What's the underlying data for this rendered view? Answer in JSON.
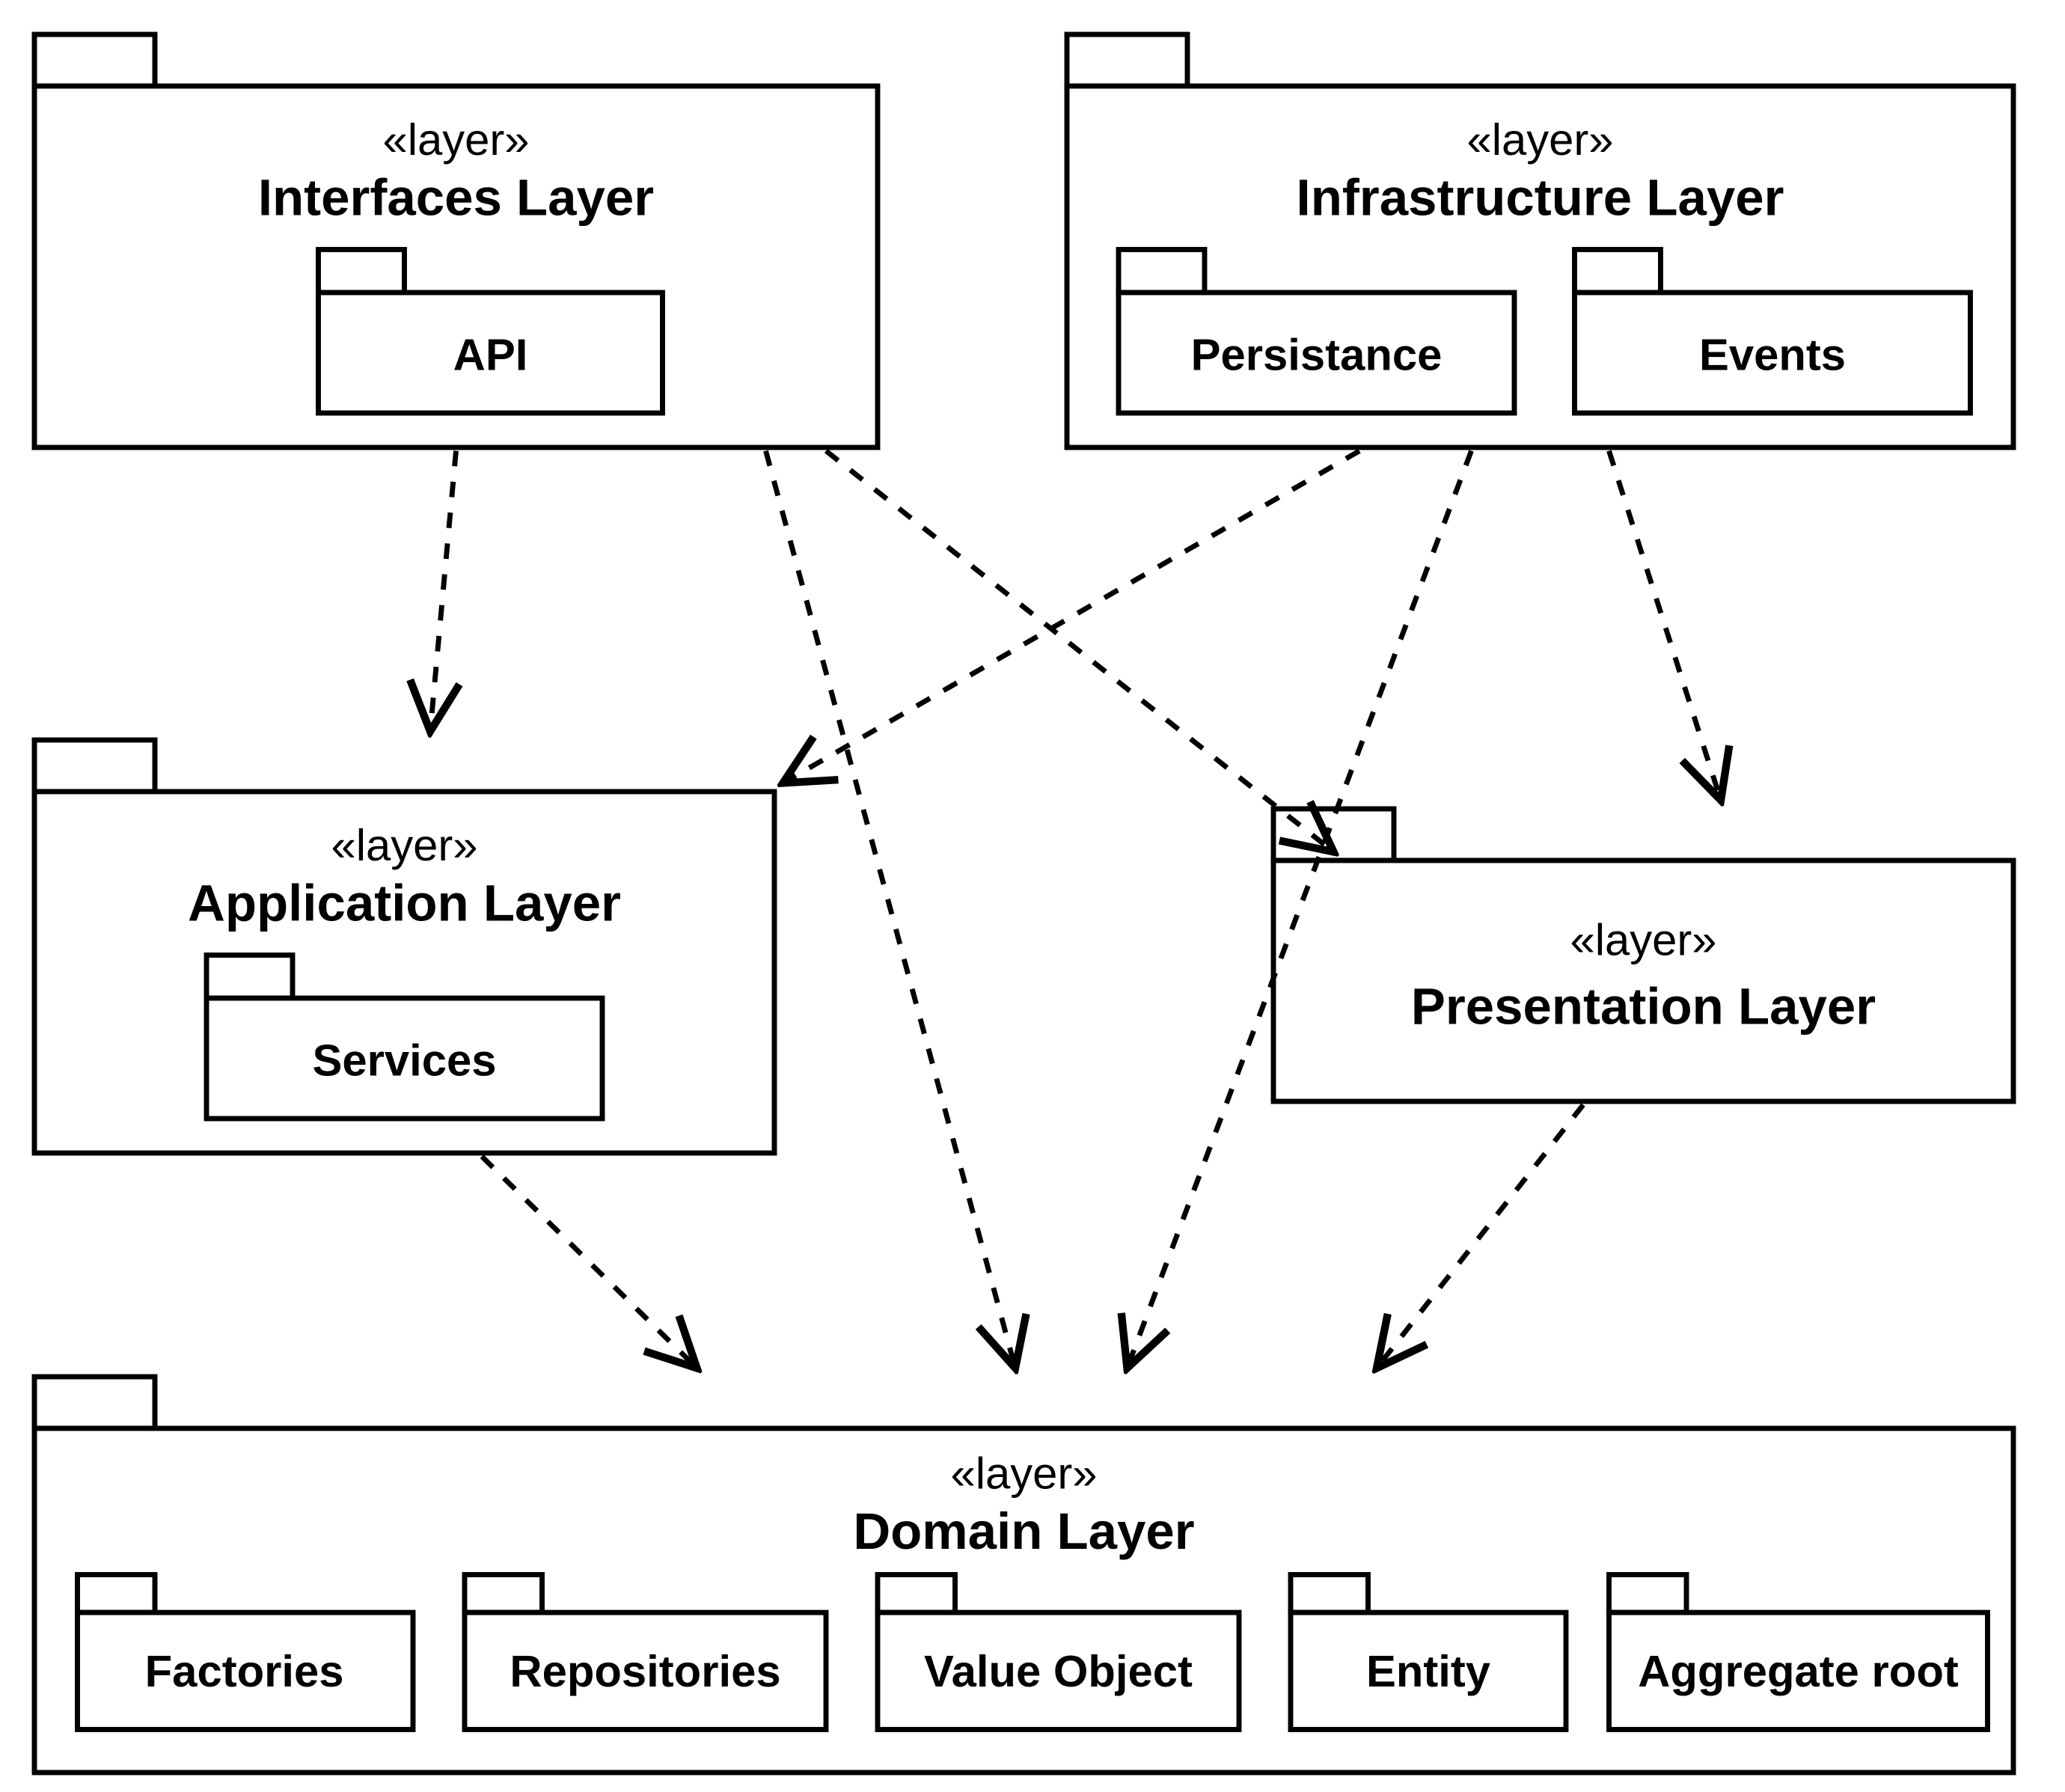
{
  "stereotype": "«layer»",
  "layers": {
    "interfaces": {
      "title": "Interfaces Layer",
      "packages": [
        "API"
      ]
    },
    "infrastructure": {
      "title": "Infrastructure Layer",
      "packages": [
        "Persistance",
        "Events"
      ]
    },
    "application": {
      "title": "Application Layer",
      "packages": [
        "Services"
      ]
    },
    "presentation": {
      "title": "Presentation Layer",
      "packages": []
    },
    "domain": {
      "title": "Domain Layer",
      "packages": [
        "Factories",
        "Repositories",
        "Value Object",
        "Entity",
        "Aggregate root"
      ]
    }
  },
  "dependencies": [
    {
      "from": "interfaces",
      "to": "application"
    },
    {
      "from": "interfaces",
      "to": "presentation"
    },
    {
      "from": "interfaces",
      "to": "domain"
    },
    {
      "from": "infrastructure",
      "to": "application"
    },
    {
      "from": "infrastructure",
      "to": "presentation"
    },
    {
      "from": "infrastructure",
      "to": "domain"
    },
    {
      "from": "application",
      "to": "domain"
    },
    {
      "from": "presentation",
      "to": "domain"
    }
  ]
}
